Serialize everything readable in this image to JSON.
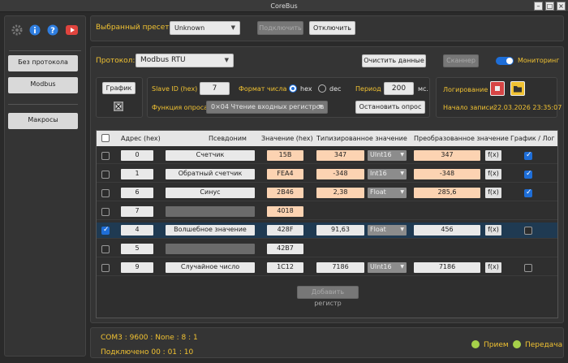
{
  "window": {
    "title": "CoreBus"
  },
  "sidebar": {
    "items": [
      {
        "label": "Без протокола"
      },
      {
        "label": "Modbus"
      },
      {
        "label": "Макросы"
      }
    ]
  },
  "preset": {
    "label": "Выбранный пресет:",
    "value": "Unknown",
    "connect": "Подключить",
    "disconnect": "Отключить"
  },
  "protocol": {
    "label": "Протокол:",
    "value": "Modbus RTU",
    "clear": "Очистить данные",
    "scanner": "Сканнер",
    "monitoring": "Мониторинг"
  },
  "poll": {
    "graph_label": "График",
    "slave_label": "Slave ID   (hex)",
    "slave_value": "7",
    "format_label": "Формат числа",
    "fmt_hex": "hex",
    "fmt_dec": "dec",
    "period_label": "Период",
    "period_value": "200",
    "period_unit": "мс.",
    "func_label": "Функция опроса",
    "func_value": "0×04 Чтение входных регистров",
    "stop": "Остановить опрос"
  },
  "logging": {
    "label": "Логирование",
    "start_label": "Начало записи:",
    "start_value": "22.03.2026 23:35:07"
  },
  "table": {
    "headers": [
      "Адрес  (hex)",
      "Псевдоним",
      "Значение  (hex)",
      "Типизированное значение",
      "Преобразованное значение",
      "График / Лог"
    ],
    "rows": [
      {
        "addr": "0",
        "alias": "Счетчик",
        "hex": "15B",
        "typed": "347",
        "type": "UInt16",
        "conv": "347",
        "fx": "f(x)"
      },
      {
        "addr": "1",
        "alias": "Обратный счетчик",
        "hex": "FEA4",
        "typed": "-348",
        "type": "Int16",
        "conv": "-348",
        "fx": "f(x)"
      },
      {
        "addr": "6",
        "alias": "Синус",
        "hex": "2B46",
        "typed": "2,38",
        "type": "Float",
        "conv": "285,6",
        "fx": "f(x)"
      },
      {
        "addr": "7",
        "alias": "",
        "hex": "4018"
      },
      {
        "addr": "4",
        "alias": "Волшебное значение",
        "hex": "428F",
        "typed": "91,63",
        "type": "Float",
        "conv": "456",
        "fx": "f(x)"
      },
      {
        "addr": "5",
        "alias": "",
        "hex": "42B7"
      },
      {
        "addr": "9",
        "alias": "Случайное число",
        "hex": "1C12",
        "typed": "7186",
        "type": "UInt16",
        "conv": "7186",
        "fx": "f(x)"
      }
    ],
    "add_register": "Добавить регистр"
  },
  "status": {
    "port": "COM3 : 9600 : None : 8 : 1",
    "connected": "Подключено  00 : 01 : 10",
    "rx": "Прием",
    "tx": "Передача"
  },
  "colors": {
    "accent": "#1e6ed8",
    "label": "#f1c232",
    "rx_led": "#a6d14a",
    "rec": "#d64545",
    "folder": "#f1c232"
  }
}
